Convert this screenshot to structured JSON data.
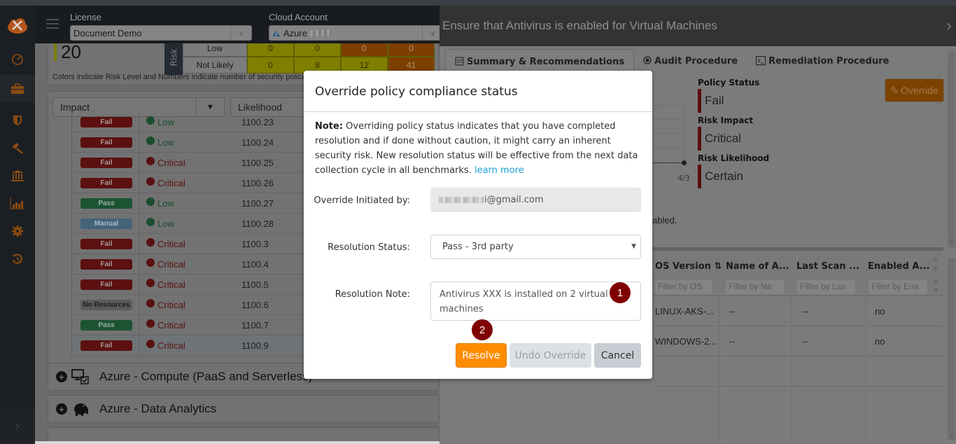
{
  "header": {
    "license_label": "License",
    "license_value": "Document Demo",
    "cloud_label": "Cloud Account",
    "cloud_value": "Azure"
  },
  "leftnav": {
    "items": [
      {
        "icon": "dashboard-gauge-icon"
      },
      {
        "icon": "briefcase-icon",
        "active": true
      },
      {
        "icon": "shield-icon"
      },
      {
        "icon": "gavel-icon"
      },
      {
        "icon": "bank-icon"
      },
      {
        "icon": "bar-chart-icon"
      },
      {
        "icon": "gear-icon"
      },
      {
        "icon": "history-icon"
      }
    ]
  },
  "summary": {
    "count": "20",
    "risk_label": "Risk",
    "heat_rows": [
      {
        "label": "Low",
        "cells": [
          "0",
          "0",
          "0",
          "0"
        ]
      },
      {
        "label": "Not Likely",
        "cells": [
          "0",
          "8",
          "12",
          "41"
        ]
      }
    ],
    "caption": "Colors indicate Risk Level and Numbers indicate number of security policies"
  },
  "filters": {
    "impact": "Impact",
    "likelihood": "Likelihood"
  },
  "policies": [
    {
      "status": "Fail",
      "impact": "Low",
      "id": "1100.23"
    },
    {
      "status": "Fail",
      "impact": "Low",
      "id": "1100.24"
    },
    {
      "status": "Fail",
      "impact": "Critical",
      "id": "1100.25"
    },
    {
      "status": "Fail",
      "impact": "Critical",
      "id": "1100.26"
    },
    {
      "status": "Pass",
      "impact": "Low",
      "id": "1100.27"
    },
    {
      "status": "Manual",
      "impact": "Low",
      "id": "1100.28"
    },
    {
      "status": "Fail",
      "impact": "Critical",
      "id": "1100.3"
    },
    {
      "status": "Fail",
      "impact": "Critical",
      "id": "1100.4"
    },
    {
      "status": "Fail",
      "impact": "Critical",
      "id": "1100.5"
    },
    {
      "status": "No Resources",
      "impact": "Critical",
      "id": "1100.6"
    },
    {
      "status": "Pass",
      "impact": "Critical",
      "id": "1100.7"
    },
    {
      "status": "Fail",
      "impact": "Critical",
      "id": "1100.9"
    }
  ],
  "accordions": [
    {
      "title": "Azure - Compute (PaaS and Serverless)",
      "icon": "monitor-check-icon"
    },
    {
      "title": "Azure - Data Analytics",
      "icon": "elephant-icon"
    }
  ],
  "detail": {
    "title": "Ensure that Antivirus is enabled for Virtual Machines",
    "tabs": [
      {
        "label": "Summary & Recommendations",
        "icon": "calendar-icon",
        "active": true
      },
      {
        "label": "Audit Procedure",
        "icon": "target-icon"
      },
      {
        "label": "Remediation Procedure",
        "icon": "terminal-icon"
      }
    ],
    "override_label": "Override",
    "policy_status_label": "Policy Status",
    "policy_status_value": "Fail",
    "risk_impact_label": "Risk Impact",
    "risk_impact_value": "Critical",
    "risk_likelihood_label": "Risk Likelihood",
    "risk_likelihood_value": "Certain",
    "chart_tick": "4/3",
    "fragment_text": "abled.",
    "table": {
      "columns": [
        "OS Version",
        "Name of A...",
        "Last Scan ...",
        "Enabled A..."
      ],
      "filters": [
        "Filter by OS",
        "Filter by Na",
        "Filter by Las",
        "Filter by Ena"
      ],
      "rows": [
        [
          "LINUX-AKS-...",
          "--",
          "--",
          "no"
        ],
        [
          "WINDOWS-2...",
          "--",
          "--",
          "no"
        ]
      ]
    }
  },
  "modal": {
    "title": "Override policy compliance status",
    "note_bold": "Note:",
    "note_text": " Overriding policy status indicates that you have completed resolution and if done without caution, it might carry an inherent security risk. New resolution status will be effective from the next data collection cycle in all benchmarks. ",
    "learn_more": "learn more",
    "initiated_label": "Override Initiated by:",
    "initiated_value": "i@gmail.com",
    "status_label": "Resolution Status:",
    "status_value": "Pass - 3rd party",
    "note_label": "Resolution Note:",
    "note_value": "Antivirus XXX is installed on 2 virtual machines",
    "marker_1": "1",
    "marker_2": "2",
    "resolve": "Resolve",
    "undo": "Undo Override",
    "cancel": "Cancel"
  },
  "colors": {
    "accent_orange": "#ff8c00",
    "fail_red": "#a51d1d",
    "pass_green": "#2e8b57",
    "marker_red": "#7f0000",
    "link_blue": "#1da1d6"
  }
}
